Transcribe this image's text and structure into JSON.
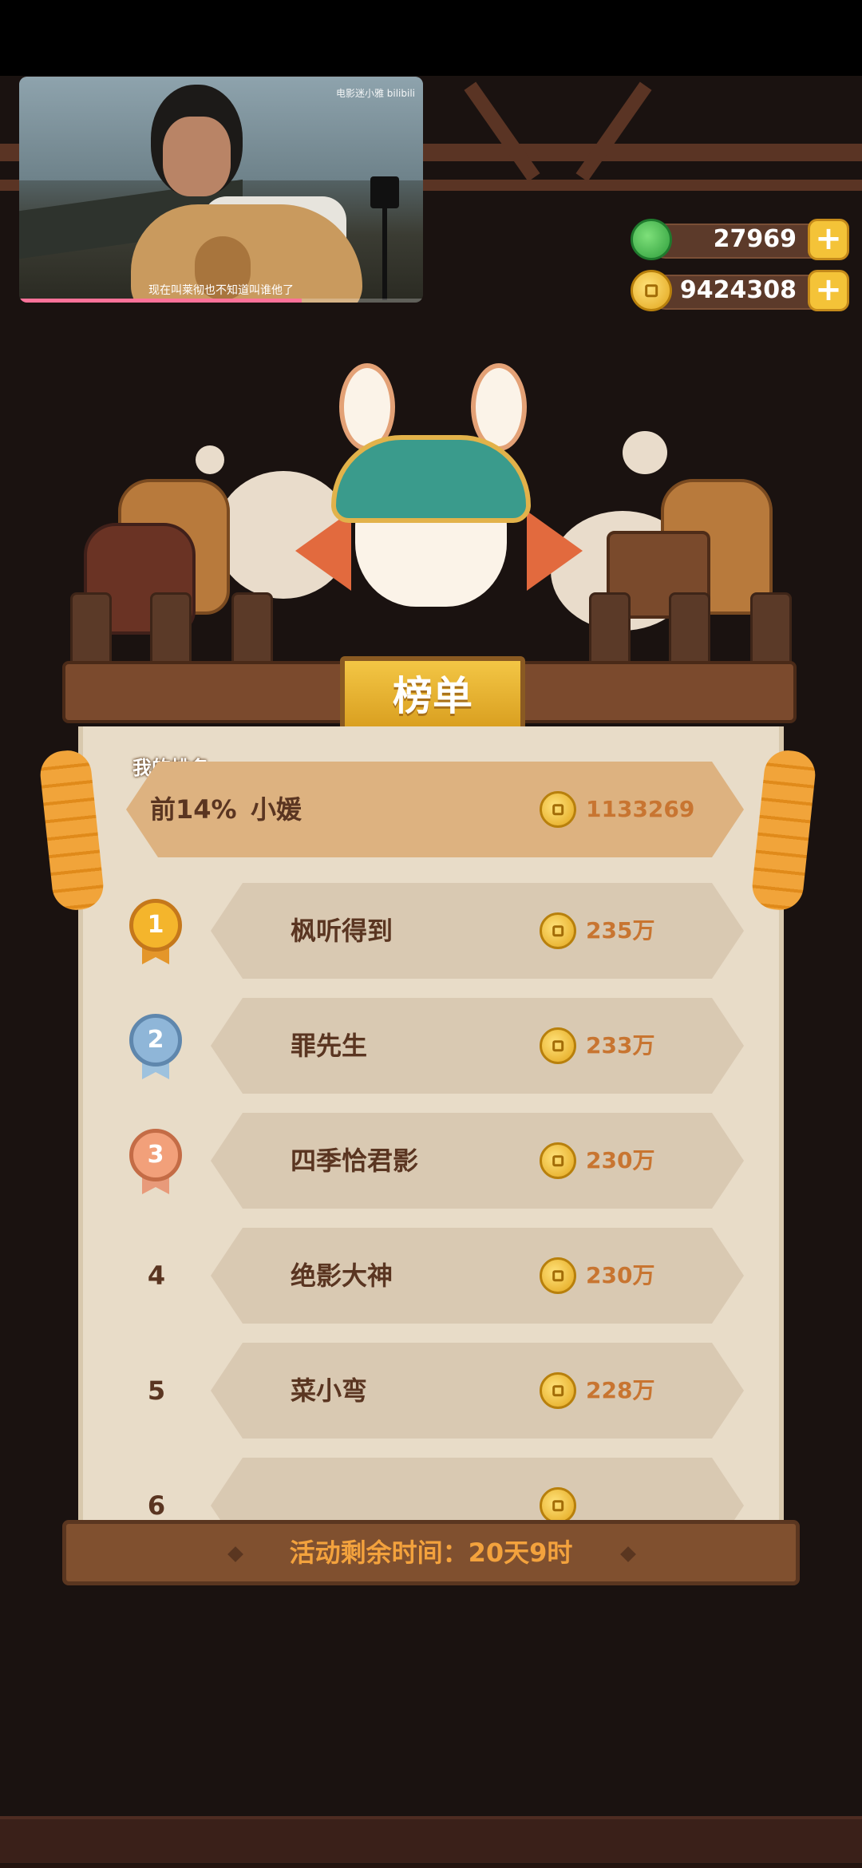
{
  "video": {
    "watermark": "电影迷小雅 bilibili",
    "subtitle": "现在叫莱彻也不知道叫谁他了",
    "progress": 0.7
  },
  "currency": {
    "jade": "27969",
    "coins": "9424308"
  },
  "leaderboard": {
    "title": "榜单",
    "my_rank_label": "我的排名",
    "my_rank": {
      "percentile": "前14%",
      "name": "小媛",
      "score": "1133269"
    },
    "entries": [
      {
        "rank": "1",
        "medal": "gold",
        "name": "枫听得到",
        "score": "235万"
      },
      {
        "rank": "2",
        "medal": "silver",
        "name": "罪先生",
        "score": "233万"
      },
      {
        "rank": "3",
        "medal": "bronze",
        "name": "四季恰君影",
        "score": "230万"
      },
      {
        "rank": "4",
        "medal": "",
        "name": "绝影大神",
        "score": "230万"
      },
      {
        "rank": "5",
        "medal": "",
        "name": "菜小弯",
        "score": "228万"
      },
      {
        "rank": "6",
        "medal": "",
        "name": "",
        "score": ""
      }
    ],
    "time_remaining": "活动剩余时间：20天9时"
  },
  "colors": {
    "accent_gold": "#f3c645",
    "score_orange": "#c87531",
    "timer_orange": "#f3a23d"
  }
}
